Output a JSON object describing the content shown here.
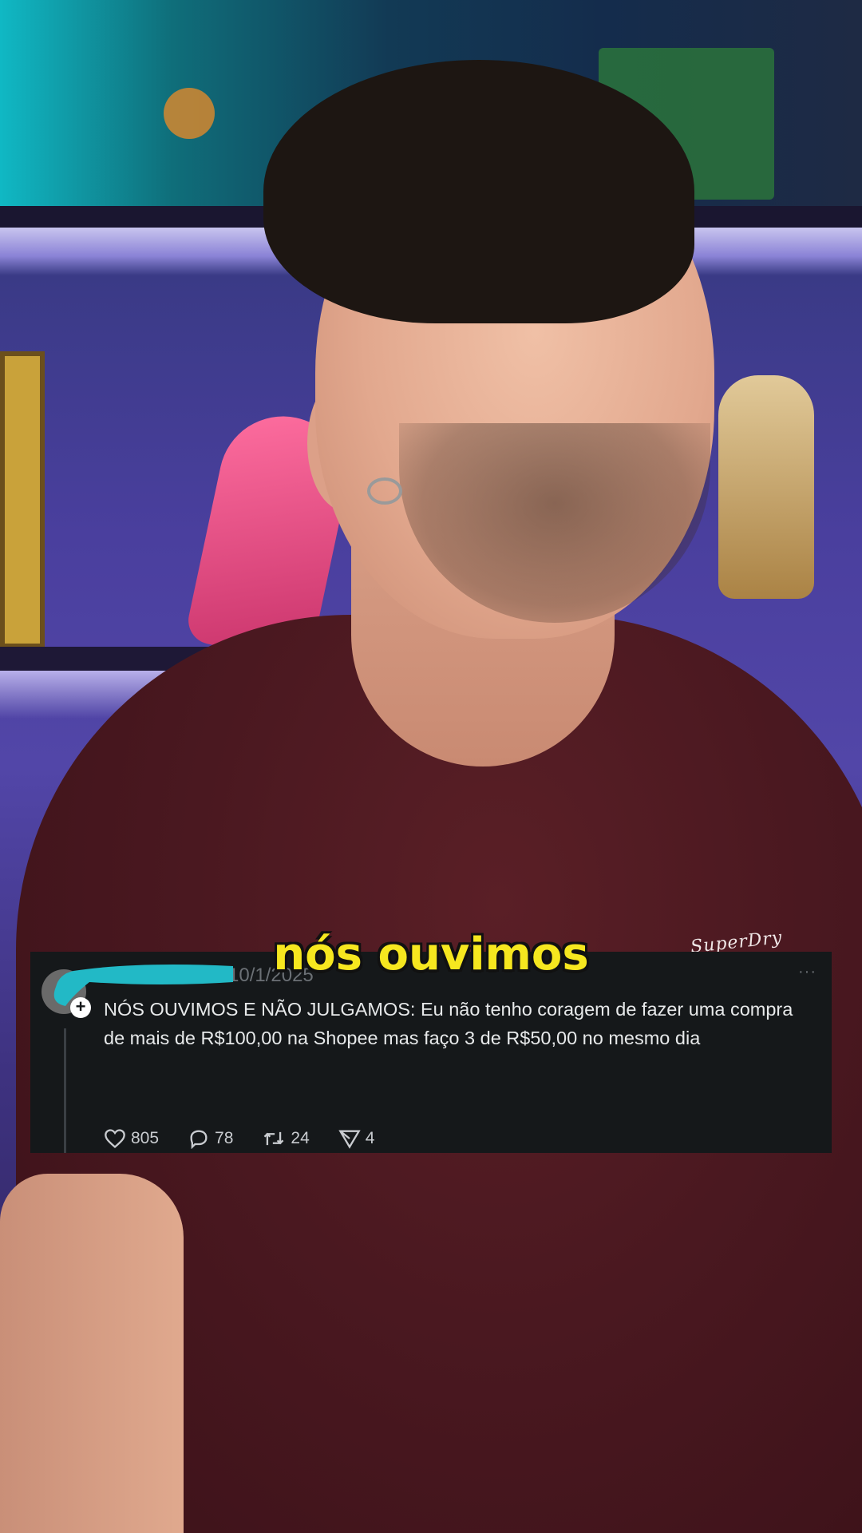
{
  "caption": "nós ouvimos",
  "shirt_logo": "SuperDry",
  "tweet": {
    "date": "10/1/2025",
    "more_icon": "···",
    "avatar_plus": "+",
    "text_line1": "NÓS OUVIMOS E NÃO JULGAMOS: Eu não tenho coragem de fazer uma compra",
    "text_line2": "de mais de R$100,00 na Shopee mas faço 3 de R$50,00 no mesmo dia",
    "actions": {
      "likes": "805",
      "replies": "78",
      "reposts": "24",
      "shares": "4"
    }
  },
  "colors": {
    "caption": "#f6e71f",
    "card_bg": "#15181a",
    "redaction": "#22b9c6"
  }
}
